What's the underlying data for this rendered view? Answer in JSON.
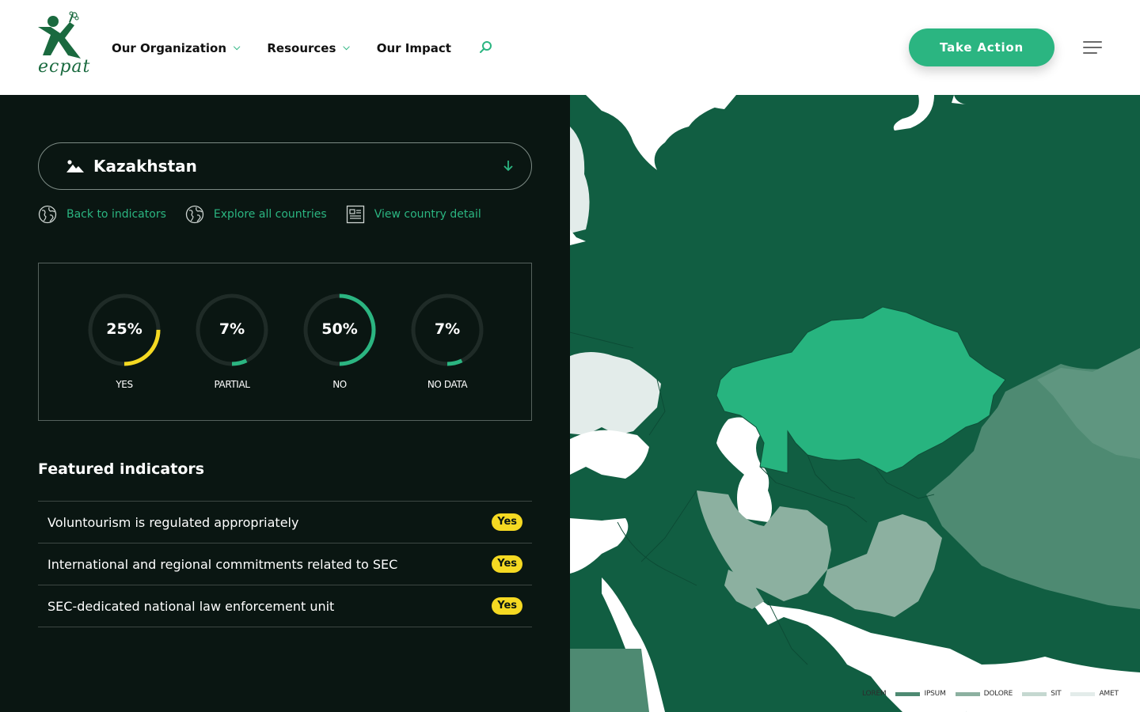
{
  "header": {
    "logo_text": "ecpat",
    "nav": [
      {
        "label": "Our Organization",
        "has_dropdown": true
      },
      {
        "label": "Resources",
        "has_dropdown": true
      },
      {
        "label": "Our Impact",
        "has_dropdown": false
      }
    ],
    "search_icon": "search-icon",
    "cta_label": "Take Action",
    "menu_icon": "hamburger-icon"
  },
  "panel": {
    "country": "Kazakhstan",
    "links": [
      {
        "label": "Back to indicators",
        "icon": "globe-icon"
      },
      {
        "label": "Explore all countries",
        "icon": "globe-icon"
      },
      {
        "label": "View country detail",
        "icon": "document-icon"
      }
    ],
    "stats": [
      {
        "label": "YES",
        "percent": 25,
        "display": "25%",
        "color": "#f5d922"
      },
      {
        "label": "PARTIAL",
        "percent": 7,
        "display": "7%",
        "color": "#2bb581"
      },
      {
        "label": "NO",
        "percent": 50,
        "display": "50%",
        "color": "#2bb581"
      },
      {
        "label": "NO DATA",
        "percent": 7,
        "display": "7%",
        "color": "#2bb581"
      }
    ],
    "featured_title": "Featured indicators",
    "indicators": [
      {
        "text": "Voluntourism is regulated appropriately",
        "value": "Yes"
      },
      {
        "text": "International and regional commitments related to SEC",
        "value": "Yes"
      },
      {
        "text": "SEC-dedicated national law enforcement unit",
        "value": "Yes"
      }
    ]
  },
  "map": {
    "highlighted_country": "Kazakhstan",
    "legend": [
      {
        "label": "LOREM",
        "color": "#115e42"
      },
      {
        "label": "IPSUM",
        "color": "#4e8a72"
      },
      {
        "label": "DOLORE",
        "color": "#8cb0a0"
      },
      {
        "label": "SIT",
        "color": "#c5d8d0"
      },
      {
        "label": "AMET",
        "color": "#e3ecea"
      }
    ]
  },
  "colors": {
    "accent": "#2bb581",
    "panel_bg": "#0a1612",
    "yes_badge": "#f5d922",
    "map_base": "#115e42",
    "highlight": "#27b47f"
  }
}
